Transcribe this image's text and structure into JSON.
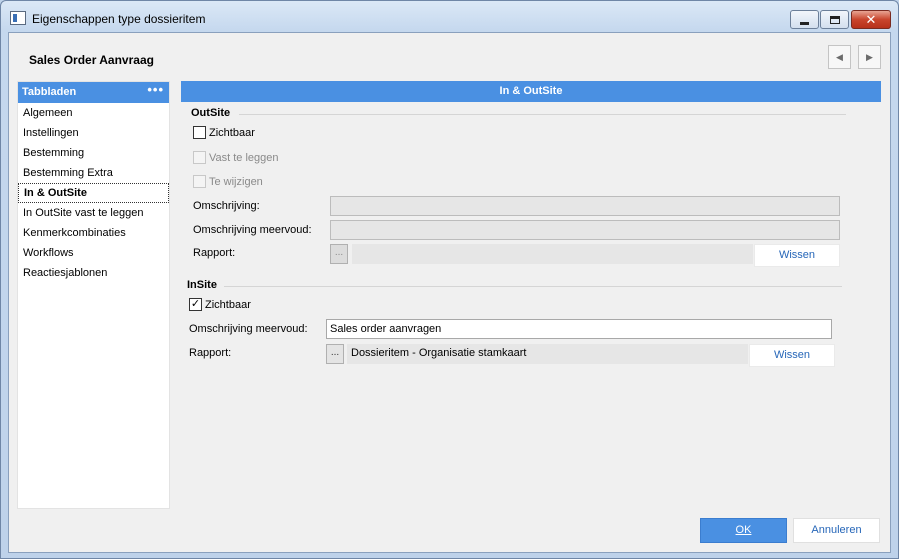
{
  "window": {
    "title": "Eigenschappen type dossieritem",
    "close_glyph": "✕"
  },
  "header": {
    "title": "Sales Order Aanvraag",
    "prev_glyph": "◀",
    "next_glyph": "▶"
  },
  "sidebar": {
    "title": "Tabbladen",
    "menu_glyph": "•••",
    "items": [
      {
        "label": "Algemeen"
      },
      {
        "label": "Instellingen"
      },
      {
        "label": "Bestemming"
      },
      {
        "label": "Bestemming Extra"
      },
      {
        "label": "In & OutSite"
      },
      {
        "label": "In OutSite vast te leggen"
      },
      {
        "label": "Kenmerkcombinaties"
      },
      {
        "label": "Workflows"
      },
      {
        "label": "Reactiesjablonen"
      }
    ],
    "active_index": 4
  },
  "panel": {
    "title": "In & OutSite"
  },
  "outsite": {
    "section_title": "OutSite",
    "zichtbaar": {
      "label": "Zichtbaar",
      "checked": false
    },
    "vast_te_leggen": {
      "label": "Vast te leggen",
      "checked": false,
      "disabled": true
    },
    "te_wijzigen": {
      "label": "Te wijzigen",
      "checked": false,
      "disabled": true
    },
    "omschrijving_label": "Omschrijving:",
    "omschrijving_value": "",
    "omschrijving_meervoud_label": "Omschrijving meervoud:",
    "omschrijving_meervoud_value": "",
    "rapport_label": "Rapport:",
    "rapport_value": "",
    "browse_label": "...",
    "wissen_label": "Wissen"
  },
  "insite": {
    "section_title": "InSite",
    "zichtbaar": {
      "label": "Zichtbaar",
      "checked": true
    },
    "check_glyph": "✓",
    "omschrijving_meervoud_label": "Omschrijving meervoud:",
    "omschrijving_meervoud_value": "Sales order aanvragen",
    "rapport_label": "Rapport:",
    "rapport_value": "Dossieritem - Organisatie stamkaart",
    "browse_label": "...",
    "wissen_label": "Wissen"
  },
  "footer": {
    "ok_label": "OK",
    "cancel_label": "Annuleren"
  }
}
